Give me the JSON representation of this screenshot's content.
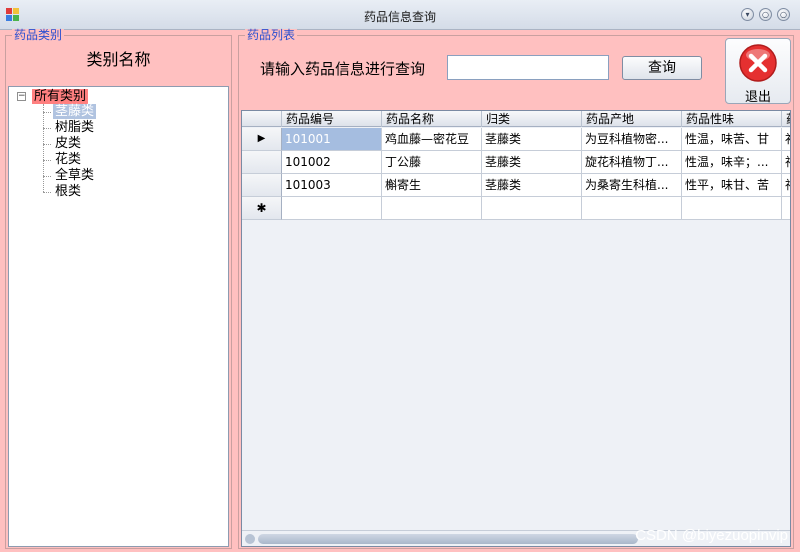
{
  "window": {
    "title": "药品信息查询",
    "buttons": {
      "minimize": "▾",
      "maximize": "○",
      "close": "○"
    }
  },
  "left_panel": {
    "group_title": "药品类别",
    "header": "类别名称",
    "tree": {
      "expander": "⊟",
      "root": "所有类别",
      "items": [
        {
          "label": "茎藤类",
          "selected": true
        },
        {
          "label": "树脂类",
          "selected": false
        },
        {
          "label": "皮类",
          "selected": false
        },
        {
          "label": "花类",
          "selected": false
        },
        {
          "label": "全草类",
          "selected": false
        },
        {
          "label": "根类",
          "selected": false
        }
      ]
    }
  },
  "right_panel": {
    "group_title": "药品列表",
    "search": {
      "label": "请输入药品信息进行查询",
      "value": "",
      "placeholder": ""
    },
    "query_button": "查询",
    "exit_button": "退出",
    "grid": {
      "columns": [
        "药品编号",
        "药品名称",
        "归类",
        "药品产地",
        "药品性味",
        "药"
      ],
      "rows": [
        {
          "marker": "▶",
          "cells": [
            "101001",
            "鸡血藤—密花豆",
            "茎藤类",
            "为豆科植物密...",
            "性温，味苦、甘",
            "补"
          ]
        },
        {
          "marker": "",
          "cells": [
            "101002",
            "丁公藤",
            "茎藤类",
            "旋花科植物丁...",
            "性温，味辛；...",
            "祛"
          ]
        },
        {
          "marker": "",
          "cells": [
            "101003",
            "槲寄生",
            "茎藤类",
            "为桑寄生科植...",
            "性平，味甘、苦",
            "祛"
          ]
        },
        {
          "marker": "✱",
          "cells": [
            "",
            "",
            "",
            "",
            "",
            ""
          ]
        }
      ]
    }
  },
  "watermark": "CSDN @biyezuopinvip",
  "colors": {
    "client_bg": "#ffc0c0",
    "tree_root_highlight": "#ff8080",
    "selection": "#a5bde0",
    "group_title": "#2a4fd0",
    "exit_red": "#e53030"
  }
}
